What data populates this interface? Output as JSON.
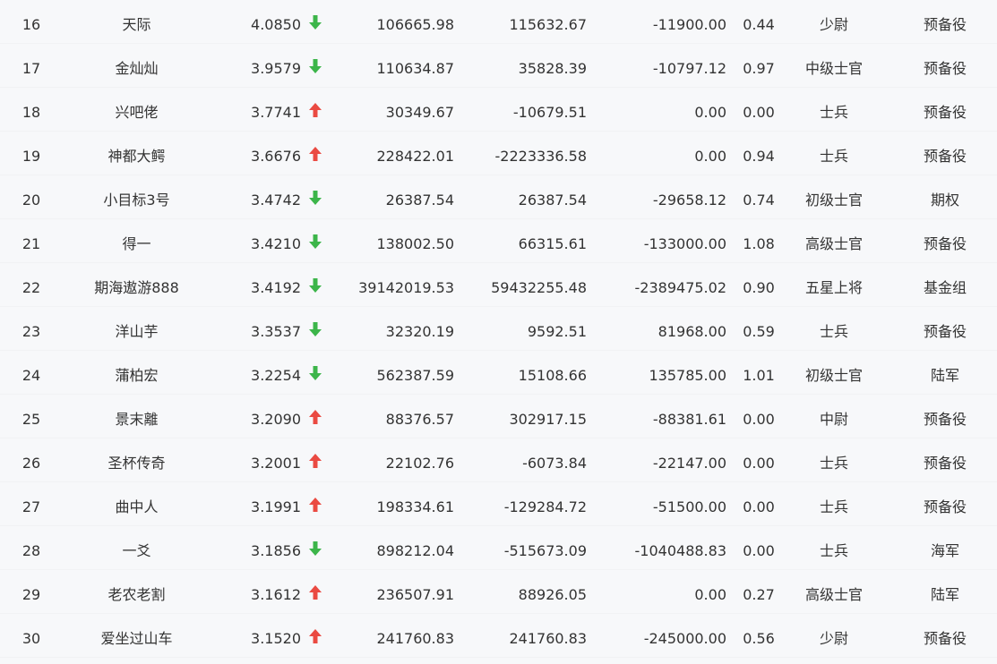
{
  "colors": {
    "up": "#ea4a42",
    "down": "#3cb54a",
    "text": "#333333",
    "background": "#f7f8fa"
  },
  "rows": [
    {
      "rank": "16",
      "name": "天际",
      "score": "4.0850",
      "trend": "down",
      "v1": "106665.98",
      "v2": "115632.67",
      "v3": "-11900.00",
      "ratio": "0.44",
      "level": "少尉",
      "group": "预备役"
    },
    {
      "rank": "17",
      "name": "金灿灿",
      "score": "3.9579",
      "trend": "down",
      "v1": "110634.87",
      "v2": "35828.39",
      "v3": "-10797.12",
      "ratio": "0.97",
      "level": "中级士官",
      "group": "预备役"
    },
    {
      "rank": "18",
      "name": "兴吧佬",
      "score": "3.7741",
      "trend": "up",
      "v1": "30349.67",
      "v2": "-10679.51",
      "v3": "0.00",
      "ratio": "0.00",
      "level": "士兵",
      "group": "预备役"
    },
    {
      "rank": "19",
      "name": "神都大鳄",
      "score": "3.6676",
      "trend": "up",
      "v1": "228422.01",
      "v2": "-2223336.58",
      "v3": "0.00",
      "ratio": "0.94",
      "level": "士兵",
      "group": "预备役"
    },
    {
      "rank": "20",
      "name": "小目标3号",
      "score": "3.4742",
      "trend": "down",
      "v1": "26387.54",
      "v2": "26387.54",
      "v3": "-29658.12",
      "ratio": "0.74",
      "level": "初级士官",
      "group": "期权"
    },
    {
      "rank": "21",
      "name": "得一",
      "score": "3.4210",
      "trend": "down",
      "v1": "138002.50",
      "v2": "66315.61",
      "v3": "-133000.00",
      "ratio": "1.08",
      "level": "高级士官",
      "group": "预备役"
    },
    {
      "rank": "22",
      "name": "期海遨游888",
      "score": "3.4192",
      "trend": "down",
      "v1": "39142019.53",
      "v2": "59432255.48",
      "v3": "-2389475.02",
      "ratio": "0.90",
      "level": "五星上将",
      "group": "基金组"
    },
    {
      "rank": "23",
      "name": "洋山芋",
      "score": "3.3537",
      "trend": "down",
      "v1": "32320.19",
      "v2": "9592.51",
      "v3": "81968.00",
      "ratio": "0.59",
      "level": "士兵",
      "group": "预备役"
    },
    {
      "rank": "24",
      "name": "蒲柏宏",
      "score": "3.2254",
      "trend": "down",
      "v1": "562387.59",
      "v2": "15108.66",
      "v3": "135785.00",
      "ratio": "1.01",
      "level": "初级士官",
      "group": "陆军"
    },
    {
      "rank": "25",
      "name": "景末離",
      "score": "3.2090",
      "trend": "up",
      "v1": "88376.57",
      "v2": "302917.15",
      "v3": "-88381.61",
      "ratio": "0.00",
      "level": "中尉",
      "group": "预备役"
    },
    {
      "rank": "26",
      "name": "圣杯传奇",
      "score": "3.2001",
      "trend": "up",
      "v1": "22102.76",
      "v2": "-6073.84",
      "v3": "-22147.00",
      "ratio": "0.00",
      "level": "士兵",
      "group": "预备役"
    },
    {
      "rank": "27",
      "name": "曲中人",
      "score": "3.1991",
      "trend": "up",
      "v1": "198334.61",
      "v2": "-129284.72",
      "v3": "-51500.00",
      "ratio": "0.00",
      "level": "士兵",
      "group": "预备役"
    },
    {
      "rank": "28",
      "name": "一爻",
      "score": "3.1856",
      "trend": "down",
      "v1": "898212.04",
      "v2": "-515673.09",
      "v3": "-1040488.83",
      "ratio": "0.00",
      "level": "士兵",
      "group": "海军"
    },
    {
      "rank": "29",
      "name": "老农老割",
      "score": "3.1612",
      "trend": "up",
      "v1": "236507.91",
      "v2": "88926.05",
      "v3": "0.00",
      "ratio": "0.27",
      "level": "高级士官",
      "group": "陆军"
    },
    {
      "rank": "30",
      "name": "爱坐过山车",
      "score": "3.1520",
      "trend": "up",
      "v1": "241760.83",
      "v2": "241760.83",
      "v3": "-245000.00",
      "ratio": "0.56",
      "level": "少尉",
      "group": "预备役"
    }
  ]
}
